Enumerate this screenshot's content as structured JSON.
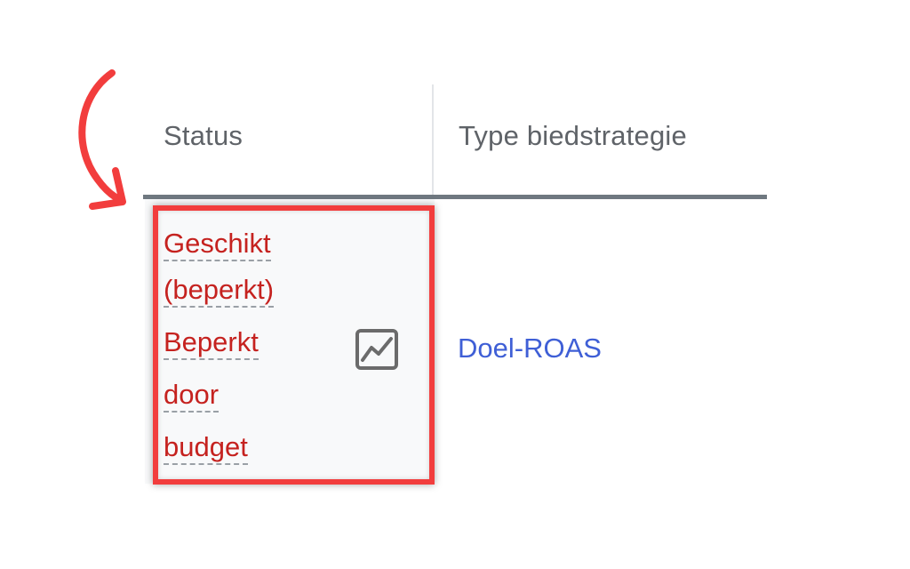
{
  "table": {
    "headers": {
      "status": "Status",
      "bid_strategy_type": "Type biedstrategie"
    },
    "row": {
      "status_lines": [
        "Geschikt",
        "(beperkt)",
        "Beperkt",
        "door",
        "budget"
      ],
      "status_color": "#c5221f",
      "status_icon": "trend-chart-icon",
      "bid_strategy": "Doel-ROAS",
      "bid_strategy_color": "#3f5fd6"
    }
  },
  "annotation": {
    "highlight_color": "#f23d3d",
    "arrow_color": "#f23d3d"
  }
}
